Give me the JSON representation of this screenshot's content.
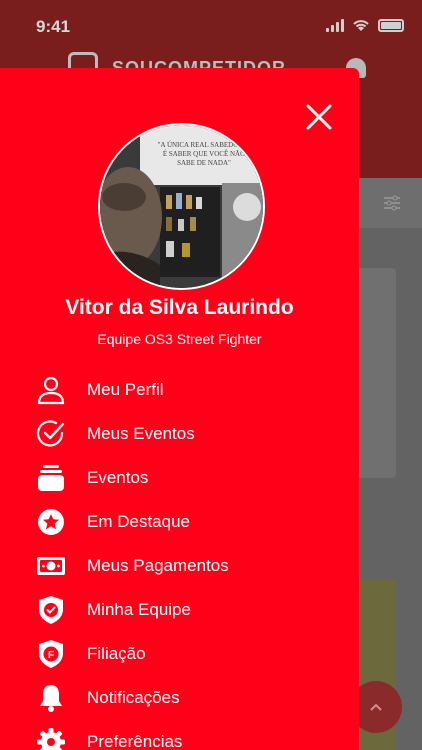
{
  "status_bar": {
    "time": "9:41"
  },
  "background_app": {
    "header_title": "SOUCOMPETIDOR"
  },
  "drawer": {
    "user": {
      "name": "Vitor da Silva Laurindo",
      "team": "Equipe OS3 Street Fighter",
      "avatar_quote": "\"A ÚNICA REAL SABEDORIA É SABER QUE VOCÊ NÃO SABE DE NADA\""
    },
    "menu_items": [
      {
        "label": "Meu Perfil",
        "icon": "person-icon"
      },
      {
        "label": "Meus Eventos",
        "icon": "check-circle-icon"
      },
      {
        "label": "Eventos",
        "icon": "stack-icon"
      },
      {
        "label": "Em Destaque",
        "icon": "star-circle-icon"
      },
      {
        "label": "Meus Pagamentos",
        "icon": "money-icon"
      },
      {
        "label": "Minha Equipe",
        "icon": "shield-check-icon"
      },
      {
        "label": "Filiação",
        "icon": "badge-f-icon"
      },
      {
        "label": "Notificações",
        "icon": "bell-icon"
      },
      {
        "label": "Preferências",
        "icon": "gear-icon"
      }
    ],
    "badge_letter": "F"
  },
  "colors": {
    "drawer_bg": "#ff0018",
    "text": "#ffffff",
    "overlay": "#5a5a5a"
  }
}
